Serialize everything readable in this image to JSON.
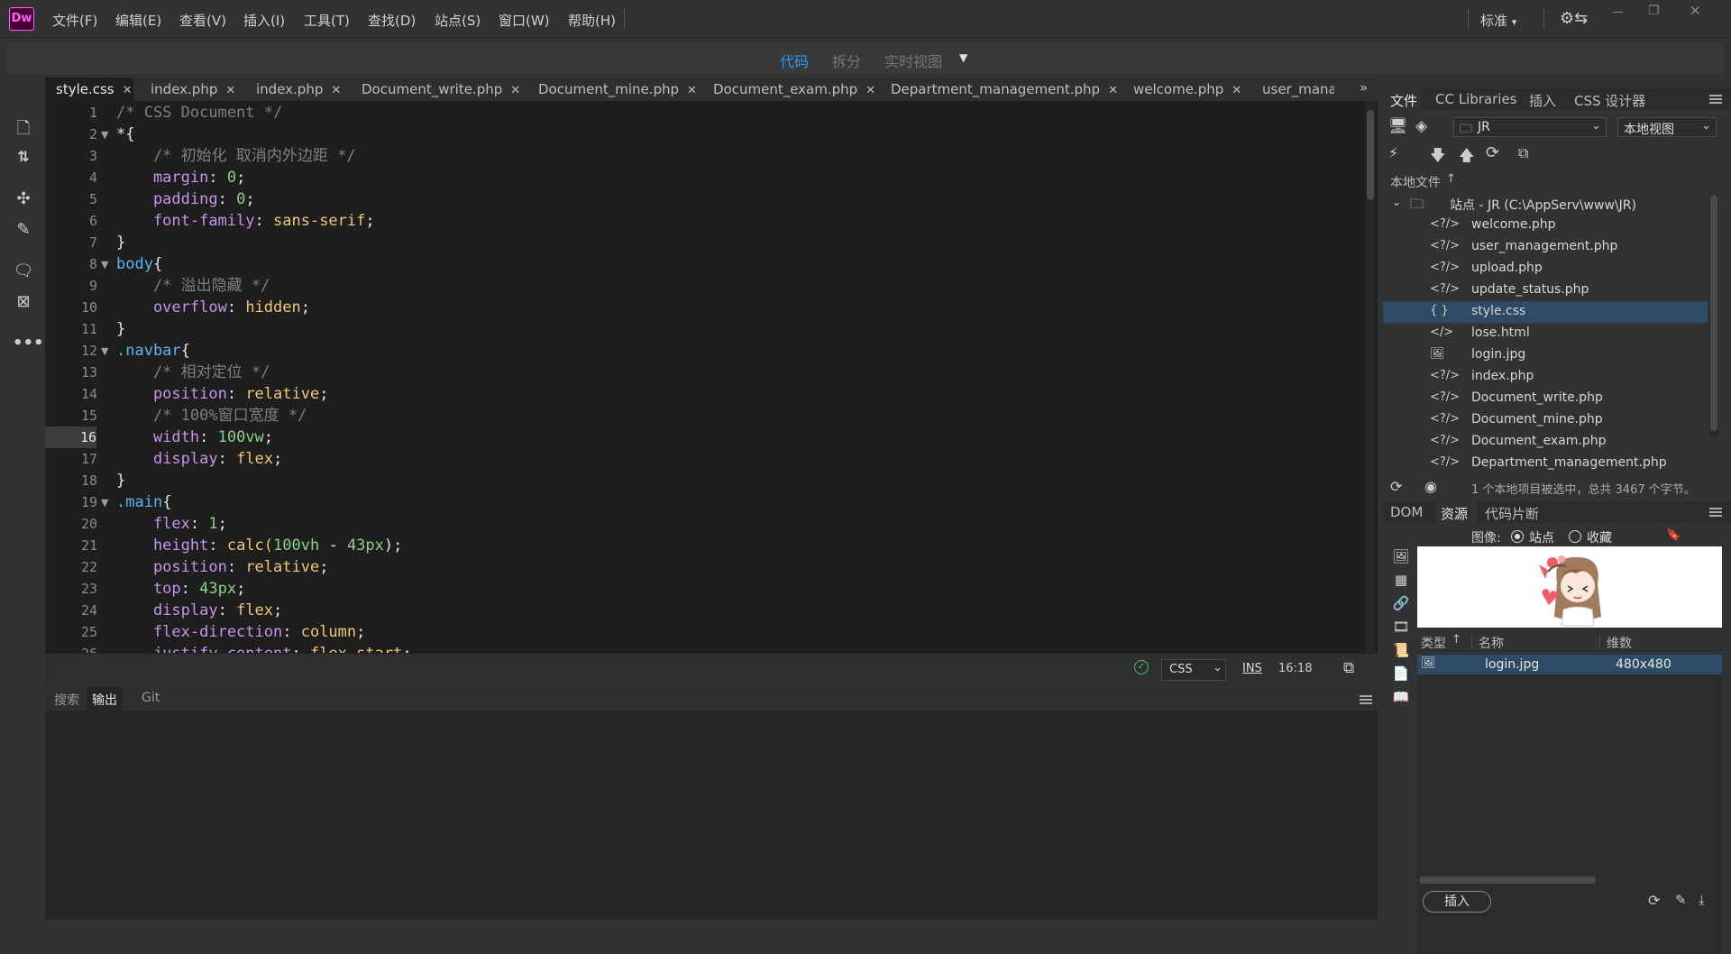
{
  "app": {
    "logo_text": "Dw",
    "menu": [
      "文件(F)",
      "编辑(E)",
      "查看(V)",
      "插入(I)",
      "工具(T)",
      "查找(D)",
      "站点(S)",
      "窗口(W)",
      "帮助(H)"
    ],
    "workspace": "标准",
    "workspace_arrow": "▾",
    "window_min": "—",
    "window_max": "❐",
    "window_close": "✕"
  },
  "view_tabs": {
    "code": "代码",
    "split": "拆分",
    "live": "实时视图",
    "dropdown": "▼",
    "active_color": "#2d9bf0"
  },
  "tabs": [
    {
      "label": "style.css",
      "close": "✕",
      "active": true
    },
    {
      "label": "index.php",
      "close": "✕"
    },
    {
      "label": "index.php",
      "close": "✕"
    },
    {
      "label": "Document_write.php",
      "close": "✕"
    },
    {
      "label": "Document_mine.php",
      "close": "✕"
    },
    {
      "label": "Document_exam.php",
      "close": "✕"
    },
    {
      "label": "Department_management.php",
      "close": "✕"
    },
    {
      "label": "welcome.php",
      "close": "✕"
    },
    {
      "label": "user_manac",
      "close": ""
    }
  ],
  "tabs_more": "»",
  "code_lines": [
    {
      "n": "1",
      "fold": "",
      "parts": [
        {
          "t": "/* CSS Document */",
          "c": "com"
        }
      ]
    },
    {
      "n": "2",
      "fold": "▼",
      "parts": [
        {
          "t": "*{",
          "c": "sel"
        }
      ]
    },
    {
      "n": "3",
      "fold": "",
      "parts": [
        {
          "t": "    /* 初始化 取消内外边距 */",
          "c": "com"
        }
      ]
    },
    {
      "n": "4",
      "fold": "",
      "parts": [
        {
          "t": "    margin",
          "c": "prop"
        },
        {
          "t": ": ",
          "c": "p"
        },
        {
          "t": "0",
          "c": "num"
        },
        {
          "t": ";",
          "c": "p"
        }
      ]
    },
    {
      "n": "5",
      "fold": "",
      "parts": [
        {
          "t": "    padding",
          "c": "prop"
        },
        {
          "t": ": ",
          "c": "p"
        },
        {
          "t": "0",
          "c": "num"
        },
        {
          "t": ";",
          "c": "p"
        }
      ]
    },
    {
      "n": "6",
      "fold": "",
      "parts": [
        {
          "t": "    font-family",
          "c": "prop"
        },
        {
          "t": ": ",
          "c": "p"
        },
        {
          "t": "sans-serif",
          "c": "val"
        },
        {
          "t": ";",
          "c": "p"
        }
      ]
    },
    {
      "n": "7",
      "fold": "",
      "parts": [
        {
          "t": "}",
          "c": "sel"
        }
      ]
    },
    {
      "n": "8",
      "fold": "▼",
      "parts": [
        {
          "t": "body",
          "c": "cls"
        },
        {
          "t": "{",
          "c": "sel"
        }
      ]
    },
    {
      "n": "9",
      "fold": "",
      "parts": [
        {
          "t": "    /* 溢出隐藏 */",
          "c": "com"
        }
      ]
    },
    {
      "n": "10",
      "fold": "",
      "parts": [
        {
          "t": "    overflow",
          "c": "prop"
        },
        {
          "t": ": ",
          "c": "p"
        },
        {
          "t": "hidden",
          "c": "val"
        },
        {
          "t": ";",
          "c": "p"
        }
      ]
    },
    {
      "n": "11",
      "fold": "",
      "parts": [
        {
          "t": "}",
          "c": "sel"
        }
      ]
    },
    {
      "n": "12",
      "fold": "▼",
      "parts": [
        {
          "t": ".navbar",
          "c": "cls"
        },
        {
          "t": "{",
          "c": "sel"
        }
      ]
    },
    {
      "n": "13",
      "fold": "",
      "parts": [
        {
          "t": "    /* 相对定位 */",
          "c": "com"
        }
      ]
    },
    {
      "n": "14",
      "fold": "",
      "parts": [
        {
          "t": "    position",
          "c": "prop"
        },
        {
          "t": ": ",
          "c": "p"
        },
        {
          "t": "relative",
          "c": "val"
        },
        {
          "t": ";",
          "c": "p"
        }
      ]
    },
    {
      "n": "15",
      "fold": "",
      "parts": [
        {
          "t": "    /* 100%窗口宽度 */",
          "c": "com"
        }
      ]
    },
    {
      "n": "16",
      "fold": "",
      "cur": true,
      "parts": [
        {
          "t": "    width",
          "c": "prop"
        },
        {
          "t": ": ",
          "c": "p"
        },
        {
          "t": "100vw",
          "c": "num"
        },
        {
          "t": ";",
          "c": "p"
        }
      ]
    },
    {
      "n": "17",
      "fold": "",
      "parts": [
        {
          "t": "    display",
          "c": "prop"
        },
        {
          "t": ": ",
          "c": "p"
        },
        {
          "t": "flex",
          "c": "val"
        },
        {
          "t": ";",
          "c": "p"
        }
      ]
    },
    {
      "n": "18",
      "fold": "",
      "parts": [
        {
          "t": "}",
          "c": "sel"
        }
      ]
    },
    {
      "n": "19",
      "fold": "▼",
      "parts": [
        {
          "t": ".main",
          "c": "cls"
        },
        {
          "t": "{",
          "c": "sel"
        }
      ]
    },
    {
      "n": "20",
      "fold": "",
      "parts": [
        {
          "t": "    flex",
          "c": "prop"
        },
        {
          "t": ": ",
          "c": "p"
        },
        {
          "t": "1",
          "c": "num"
        },
        {
          "t": ";",
          "c": "p"
        }
      ]
    },
    {
      "n": "21",
      "fold": "",
      "parts": [
        {
          "t": "    height",
          "c": "prop"
        },
        {
          "t": ": ",
          "c": "p"
        },
        {
          "t": "calc(",
          "c": "val"
        },
        {
          "t": "100vh",
          "c": "num"
        },
        {
          "t": " - ",
          "c": "p"
        },
        {
          "t": "43px",
          "c": "num"
        },
        {
          "t": ");",
          "c": "p"
        }
      ]
    },
    {
      "n": "22",
      "fold": "",
      "parts": [
        {
          "t": "    position",
          "c": "prop"
        },
        {
          "t": ": ",
          "c": "p"
        },
        {
          "t": "relative",
          "c": "val"
        },
        {
          "t": ";",
          "c": "p"
        }
      ]
    },
    {
      "n": "23",
      "fold": "",
      "parts": [
        {
          "t": "    top",
          "c": "prop"
        },
        {
          "t": ": ",
          "c": "p"
        },
        {
          "t": "43px",
          "c": "num"
        },
        {
          "t": ";",
          "c": "p"
        }
      ]
    },
    {
      "n": "24",
      "fold": "",
      "parts": [
        {
          "t": "    display",
          "c": "prop"
        },
        {
          "t": ": ",
          "c": "p"
        },
        {
          "t": "flex",
          "c": "val"
        },
        {
          "t": ";",
          "c": "p"
        }
      ]
    },
    {
      "n": "25",
      "fold": "",
      "parts": [
        {
          "t": "    flex-direction",
          "c": "prop"
        },
        {
          "t": ": ",
          "c": "p"
        },
        {
          "t": "column",
          "c": "val"
        },
        {
          "t": ";",
          "c": "p"
        }
      ]
    },
    {
      "n": "26",
      "fold": "",
      "parts": [
        {
          "t": "    justify-content",
          "c": "prop"
        },
        {
          "t": ": ",
          "c": "p"
        },
        {
          "t": "flex-start",
          "c": "val"
        },
        {
          "t": ";",
          "c": "p"
        }
      ]
    }
  ],
  "status": {
    "ok_icon": "✓",
    "lang": "CSS",
    "lang_arrow": "⌄",
    "ins": "INS",
    "pos": "16:18"
  },
  "output_tabs": [
    "搜索",
    "输出",
    "Git"
  ],
  "files_panel": {
    "tabs": [
      "文件",
      "CC Libraries",
      "插入",
      "CSS 设计器"
    ],
    "site_select": "JR",
    "view_select": "本地视图",
    "header": "本地文件",
    "header_sort": "↑",
    "root": "站点 - JR (C:\\AppServ\\www\\JR)",
    "files": [
      {
        "icon": "<?/>",
        "name": "welcome.php"
      },
      {
        "icon": "<?/>",
        "name": "user_management.php"
      },
      {
        "icon": "<?/>",
        "name": "upload.php"
      },
      {
        "icon": "<?/>",
        "name": "update_status.php"
      },
      {
        "icon": "{ }",
        "name": "style.css",
        "selected": true
      },
      {
        "icon": "</>",
        "name": "lose.html"
      },
      {
        "icon": "img",
        "name": "login.jpg"
      },
      {
        "icon": "<?/>",
        "name": "index.php"
      },
      {
        "icon": "<?/>",
        "name": "Document_write.php"
      },
      {
        "icon": "<?/>",
        "name": "Document_mine.php"
      },
      {
        "icon": "<?/>",
        "name": "Document_exam.php"
      },
      {
        "icon": "<?/>",
        "name": "Department_management.php"
      }
    ],
    "status_text": "1 个本地项目被选中，总共 3467 个字节。"
  },
  "assets_panel": {
    "tabs": [
      "DOM",
      "资源",
      "代码片断"
    ],
    "image_label": "图像:",
    "radio_site": "站点",
    "radio_fav": "收藏",
    "columns": [
      "类型",
      "名称",
      "维数"
    ],
    "type_sort": "↑",
    "row": {
      "name": "login.jpg",
      "dims": "480x480"
    },
    "insert_button": "插入"
  }
}
